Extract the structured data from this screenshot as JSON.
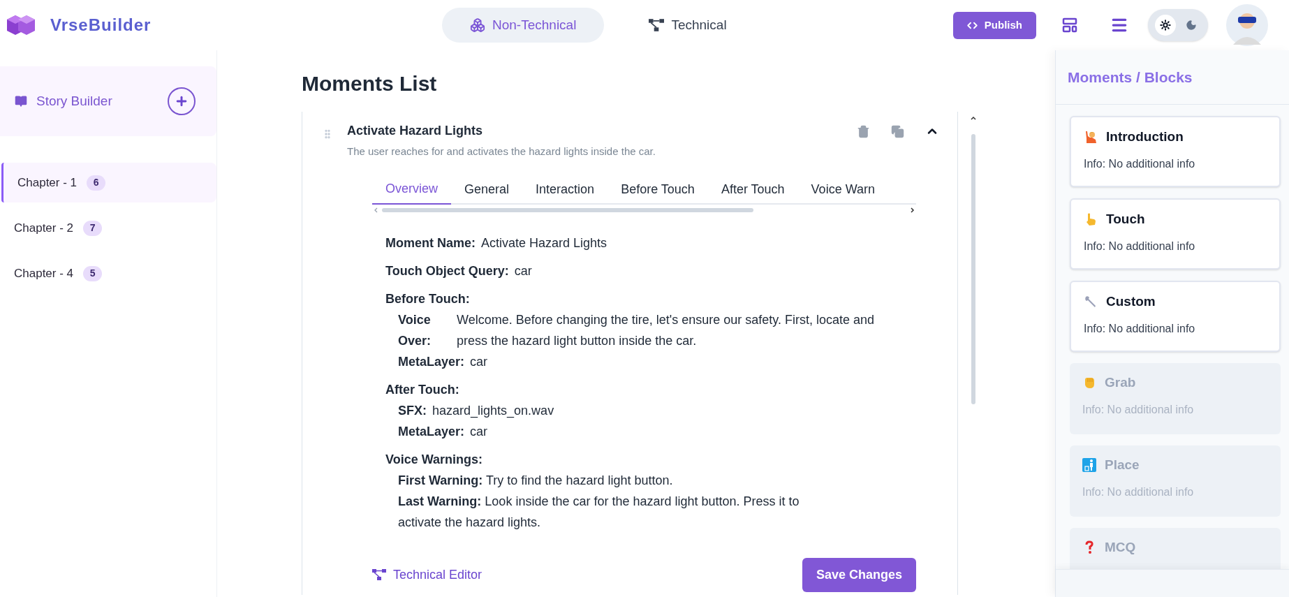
{
  "app": {
    "name": "VrseBuilder"
  },
  "mode_switch": [
    {
      "kind": "non_technical",
      "label": "Non-Technical",
      "selected": true
    },
    {
      "kind": "technical",
      "label": "Technical",
      "selected": false
    }
  ],
  "publish_button": "Publish",
  "theme_toggle": [
    {
      "kind": "light",
      "selected": true
    },
    {
      "kind": "dark",
      "selected": false
    }
  ],
  "sidebar": {
    "title": "Story Builder",
    "chapters": [
      {
        "label": "Chapter - 1",
        "count": "6",
        "selected": true
      },
      {
        "label": "Chapter - 2",
        "count": "7",
        "selected": false
      },
      {
        "label": "Chapter - 4",
        "count": "5",
        "selected": false
      }
    ]
  },
  "main": {
    "title": "Moments List",
    "moment": {
      "title": "Activate Hazard Lights",
      "description": "The user reaches for and activates the hazard lights inside the car.",
      "expanded": true,
      "tabs": [
        {
          "label": "Overview",
          "selected": true
        },
        {
          "label": "General",
          "selected": false
        },
        {
          "label": "Interaction",
          "selected": false
        },
        {
          "label": "Before Touch",
          "selected": false
        },
        {
          "label": "After Touch",
          "selected": false
        },
        {
          "label": "Voice Warn",
          "selected": false
        }
      ],
      "fields": [
        {
          "label": "Moment Name:",
          "value": "Activate Hazard Lights"
        },
        {
          "label": "Touch Object Query:",
          "value": "car"
        }
      ],
      "sections": [
        {
          "title": "Before Touch:",
          "items": [
            {
              "kind": "column",
              "label": "Voice Over:",
              "value": "Welcome. Before changing the tire, let's ensure our safety. First, locate and press the hazard light button inside the car."
            },
            {
              "kind": "inline",
              "label": "MetaLayer:",
              "value": "car"
            }
          ]
        },
        {
          "title": "After Touch:",
          "items": [
            {
              "kind": "inline",
              "label": "SFX:",
              "value": "hazard_lights_on.wav"
            },
            {
              "kind": "inline",
              "label": "MetaLayer:",
              "value": "car"
            }
          ]
        },
        {
          "title": "Voice Warnings:",
          "items": [
            {
              "kind": "run",
              "text": "**First Warning:** Try to find the hazard light button."
            },
            {
              "kind": "run",
              "text": "**Last Warning:** Look inside the car for the hazard light button. Press it to activate the hazard lights."
            }
          ]
        }
      ],
      "technical_link": "Technical Editor",
      "save_button": "Save Changes"
    }
  },
  "blocks_panel": {
    "title": "Moments / Blocks",
    "blocks": [
      {
        "kind": "introduction",
        "title": "Introduction",
        "info": "Info: No additional info",
        "disabled": false
      },
      {
        "kind": "touch",
        "title": "Touch",
        "info": "Info: No additional info",
        "disabled": false
      },
      {
        "kind": "custom",
        "title": "Custom",
        "info": "Info: No additional info",
        "disabled": false
      },
      {
        "kind": "grab",
        "title": "Grab",
        "info": "Info: No additional info",
        "disabled": true
      },
      {
        "kind": "place",
        "title": "Place",
        "info": "Info: No additional info",
        "disabled": true
      },
      {
        "kind": "mcq",
        "title": "MCQ",
        "disabled": true
      }
    ]
  }
}
